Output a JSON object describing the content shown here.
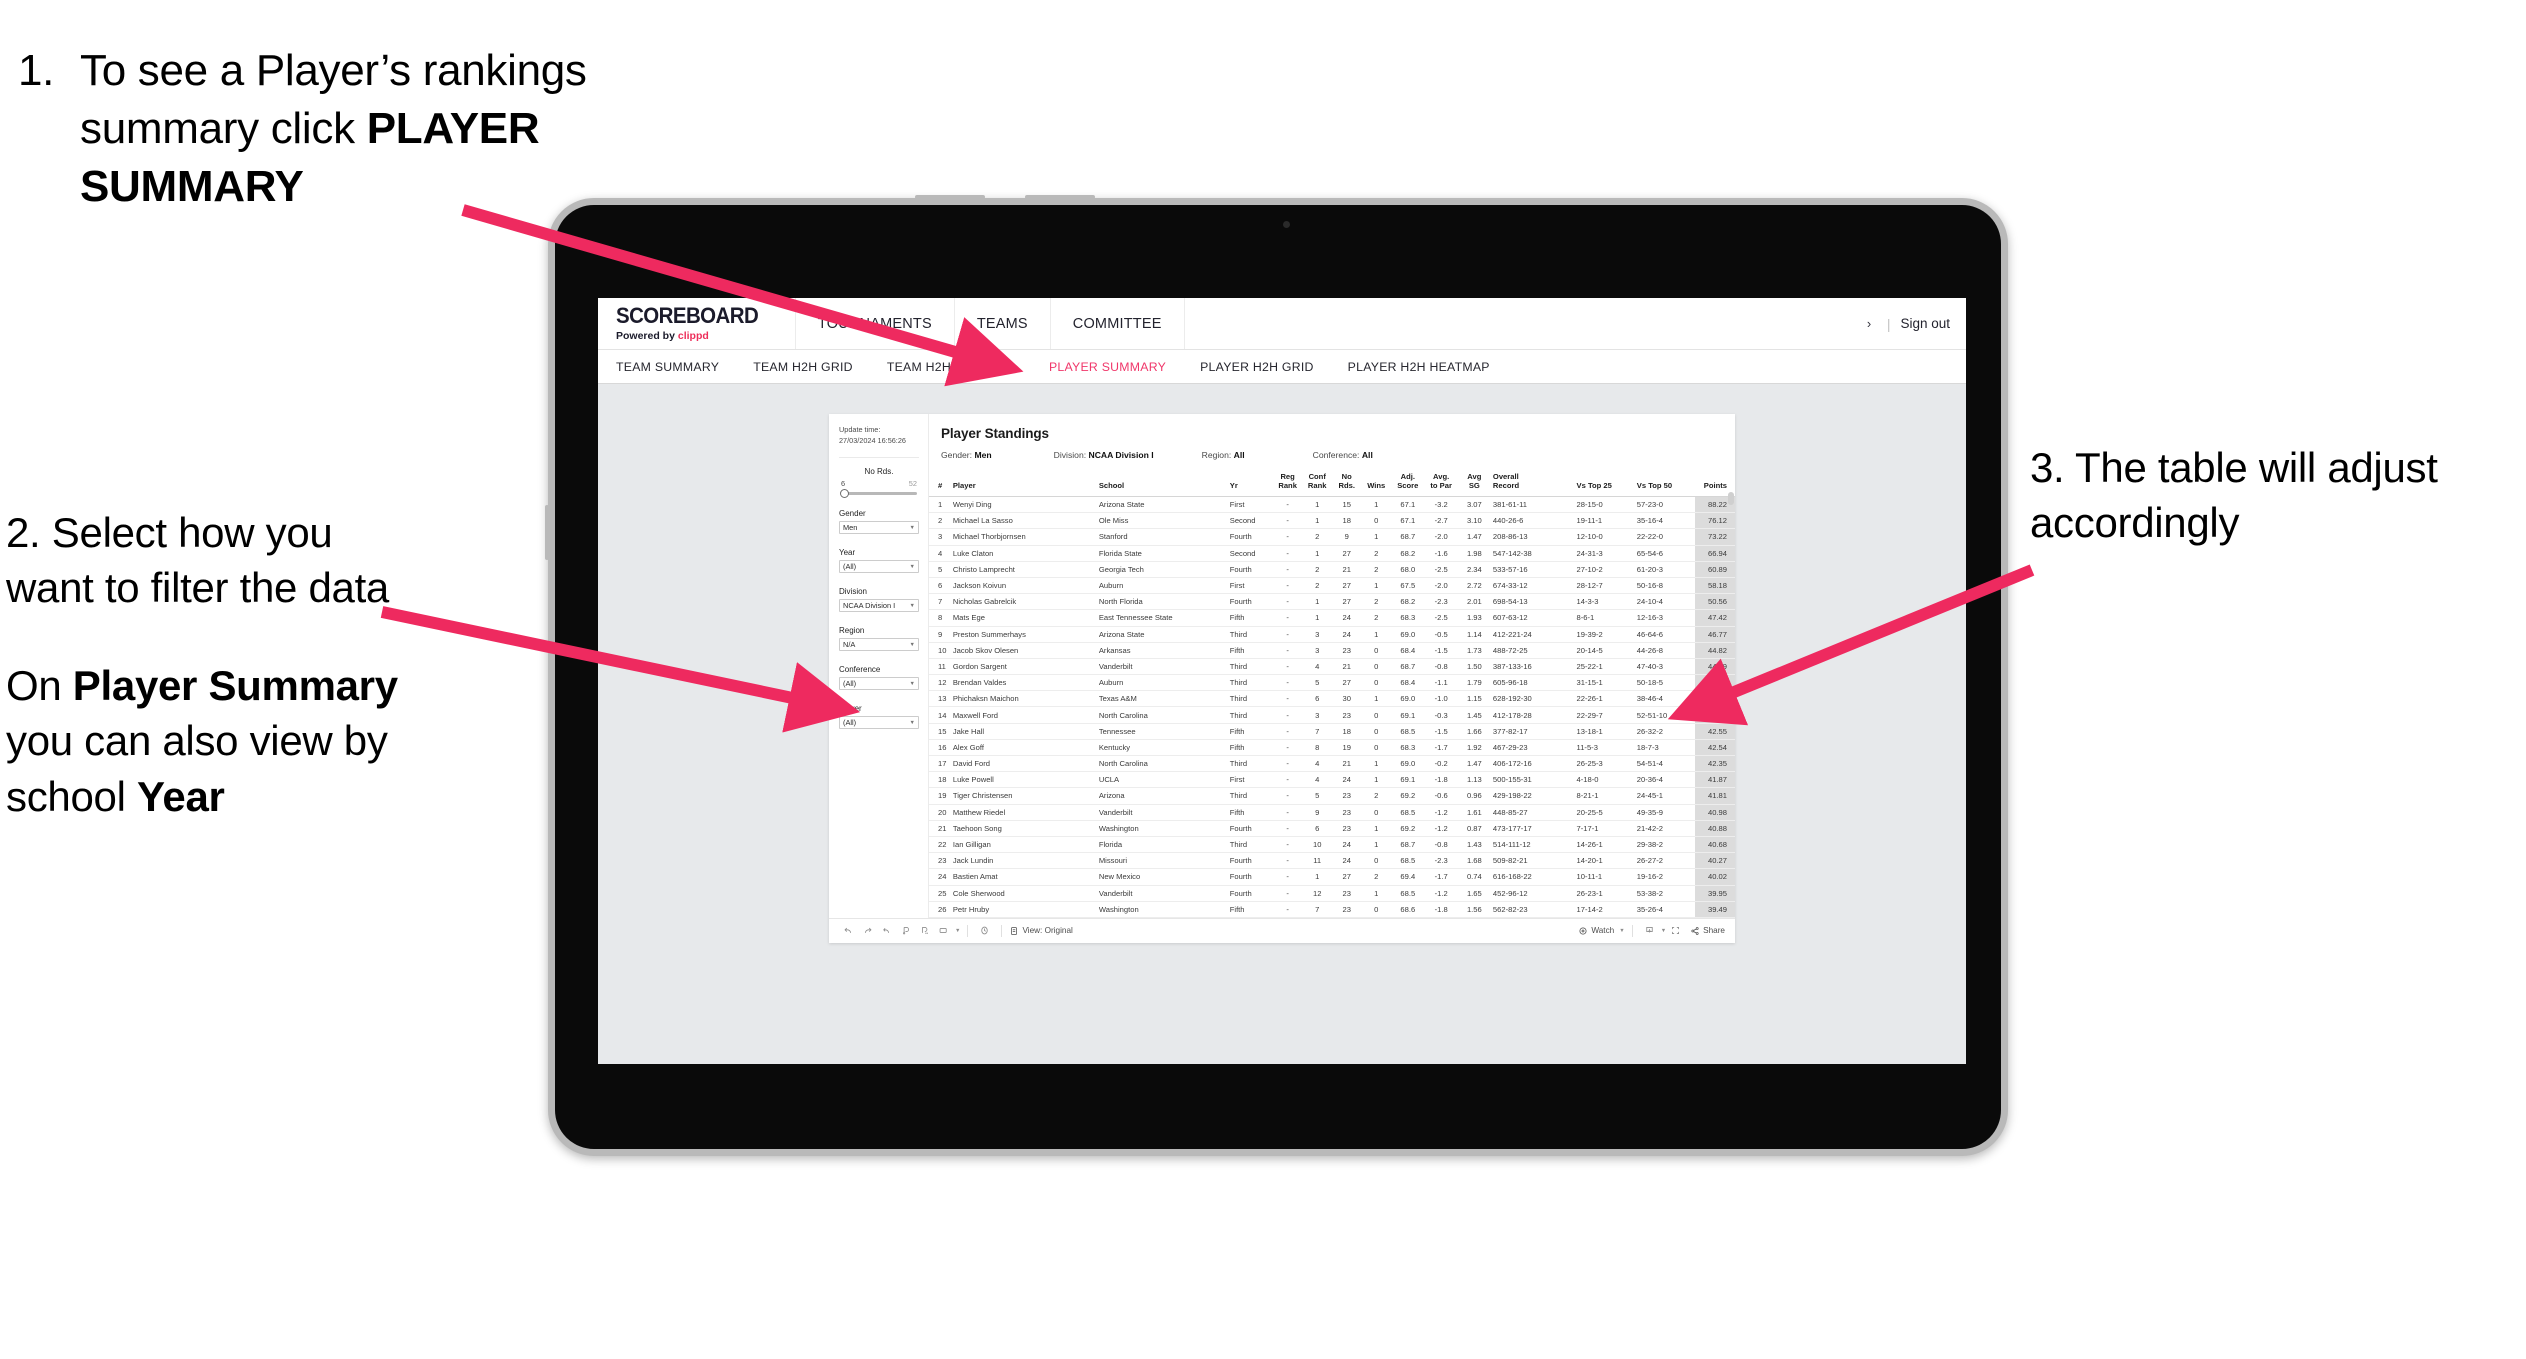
{
  "annotations": {
    "a1_num": "1.",
    "a1_line1": "To see a Player’s rankings",
    "a1_line2a": "summary click ",
    "a1_line2b": "PLAYER",
    "a1_line3b": "SUMMARY",
    "a2_p1": "2. Select how you want to filter the data",
    "a2_p2a": "On ",
    "a2_p2b": "Player Summary",
    "a2_p2c": " you can also view by school ",
    "a2_p2d": "Year",
    "a3": "3. The table will adjust accordingly"
  },
  "app": {
    "logo_word": "SCOREBOARD",
    "logo_sub_prefix": "Powered by ",
    "logo_sub_brand": "clippd",
    "top_nav": [
      "TOURNAMENTS",
      "TEAMS",
      "COMMITTEE"
    ],
    "header_right": {
      "truncated": "›",
      "divider": "|",
      "sign_out": "Sign out"
    },
    "sub_nav": [
      {
        "label": "TEAM SUMMARY",
        "active": false
      },
      {
        "label": "TEAM H2H GRID",
        "active": false
      },
      {
        "label": "TEAM H2H HEATMAP",
        "active": false
      },
      {
        "label": "PLAYER SUMMARY",
        "active": true
      },
      {
        "label": "PLAYER H2H GRID",
        "active": false
      },
      {
        "label": "PLAYER H2H HEATMAP",
        "active": false
      }
    ]
  },
  "filters": {
    "update_label": "Update time:",
    "update_value": "27/03/2024 16:56:26",
    "slider": {
      "label": "No Rds.",
      "min": "6",
      "max": "52"
    },
    "selects": [
      {
        "label": "Gender",
        "value": "Men"
      },
      {
        "label": "Year",
        "value": "(All)"
      },
      {
        "label": "Division",
        "value": "NCAA Division I"
      },
      {
        "label": "Region",
        "value": "N/A"
      },
      {
        "label": "Conference",
        "value": "(All)"
      },
      {
        "label": "Player",
        "value": "(All)"
      }
    ]
  },
  "viz": {
    "title": "Player Standings",
    "meta": [
      {
        "key": "Gender:",
        "value": "Men"
      },
      {
        "key": "Division:",
        "value": "NCAA Division I"
      },
      {
        "key": "Region:",
        "value": "All"
      },
      {
        "key": "Conference:",
        "value": "All"
      }
    ],
    "columns": [
      {
        "l1": "#",
        "l2": ""
      },
      {
        "l1": "Player",
        "l2": ""
      },
      {
        "l1": "School",
        "l2": ""
      },
      {
        "l1": "Yr",
        "l2": ""
      },
      {
        "l1": "Reg",
        "l2": "Rank"
      },
      {
        "l1": "Conf",
        "l2": "Rank"
      },
      {
        "l1": "No",
        "l2": "Rds."
      },
      {
        "l1": "Wins",
        "l2": ""
      },
      {
        "l1": "Adj.",
        "l2": "Score"
      },
      {
        "l1": "Avg.",
        "l2": "to Par"
      },
      {
        "l1": "Avg",
        "l2": "SG"
      },
      {
        "l1": "Overall",
        "l2": "Record"
      },
      {
        "l1": "Vs Top 25",
        "l2": ""
      },
      {
        "l1": "Vs Top 50",
        "l2": ""
      },
      {
        "l1": "Points",
        "l2": ""
      }
    ],
    "rows": [
      [
        "1",
        "Wenyi Ding",
        "Arizona State",
        "First",
        "-",
        "1",
        "15",
        "1",
        "67.1",
        "-3.2",
        "3.07",
        "381-61-11",
        "28-15-0",
        "57-23-0",
        "88.22"
      ],
      [
        "2",
        "Michael La Sasso",
        "Ole Miss",
        "Second",
        "-",
        "1",
        "18",
        "0",
        "67.1",
        "-2.7",
        "3.10",
        "440-26-6",
        "19-11-1",
        "35-16-4",
        "76.12"
      ],
      [
        "3",
        "Michael Thorbjornsen",
        "Stanford",
        "Fourth",
        "-",
        "2",
        "9",
        "1",
        "68.7",
        "-2.0",
        "1.47",
        "208-86-13",
        "12-10-0",
        "22-22-0",
        "73.22"
      ],
      [
        "4",
        "Luke Claton",
        "Florida State",
        "Second",
        "-",
        "1",
        "27",
        "2",
        "68.2",
        "-1.6",
        "1.98",
        "547-142-38",
        "24-31-3",
        "65-54-6",
        "66.94"
      ],
      [
        "5",
        "Christo Lamprecht",
        "Georgia Tech",
        "Fourth",
        "-",
        "2",
        "21",
        "2",
        "68.0",
        "-2.5",
        "2.34",
        "533-57-16",
        "27-10-2",
        "61-20-3",
        "60.89"
      ],
      [
        "6",
        "Jackson Koivun",
        "Auburn",
        "First",
        "-",
        "2",
        "27",
        "1",
        "67.5",
        "-2.0",
        "2.72",
        "674-33-12",
        "28-12-7",
        "50-16-8",
        "58.18"
      ],
      [
        "7",
        "Nicholas Gabrelcik",
        "North Florida",
        "Fourth",
        "-",
        "1",
        "27",
        "2",
        "68.2",
        "-2.3",
        "2.01",
        "698-54-13",
        "14-3-3",
        "24-10-4",
        "50.56"
      ],
      [
        "8",
        "Mats Ege",
        "East Tennessee State",
        "Fifth",
        "-",
        "1",
        "24",
        "2",
        "68.3",
        "-2.5",
        "1.93",
        "607-63-12",
        "8-6-1",
        "12-16-3",
        "47.42"
      ],
      [
        "9",
        "Preston Summerhays",
        "Arizona State",
        "Third",
        "-",
        "3",
        "24",
        "1",
        "69.0",
        "-0.5",
        "1.14",
        "412-221-24",
        "19-39-2",
        "46-64-6",
        "46.77"
      ],
      [
        "10",
        "Jacob Skov Olesen",
        "Arkansas",
        "Fifth",
        "-",
        "3",
        "23",
        "0",
        "68.4",
        "-1.5",
        "1.73",
        "488-72-25",
        "20-14-5",
        "44-26-8",
        "44.82"
      ],
      [
        "11",
        "Gordon Sargent",
        "Vanderbilt",
        "Third",
        "-",
        "4",
        "21",
        "0",
        "68.7",
        "-0.8",
        "1.50",
        "387-133-16",
        "25-22-1",
        "47-40-3",
        "44.49"
      ],
      [
        "12",
        "Brendan Valdes",
        "Auburn",
        "Third",
        "-",
        "5",
        "27",
        "0",
        "68.4",
        "-1.1",
        "1.79",
        "605-96-18",
        "31-15-1",
        "50-18-5",
        "43.95"
      ],
      [
        "13",
        "Phichaksn Maichon",
        "Texas A&M",
        "Third",
        "-",
        "6",
        "30",
        "1",
        "69.0",
        "-1.0",
        "1.15",
        "628-192-30",
        "22-26-1",
        "38-46-4",
        "43.83"
      ],
      [
        "14",
        "Maxwell Ford",
        "North Carolina",
        "Third",
        "-",
        "3",
        "23",
        "0",
        "69.1",
        "-0.3",
        "1.45",
        "412-178-28",
        "22-29-7",
        "52-51-10",
        "42.75"
      ],
      [
        "15",
        "Jake Hall",
        "Tennessee",
        "Fifth",
        "-",
        "7",
        "18",
        "0",
        "68.5",
        "-1.5",
        "1.66",
        "377-82-17",
        "13-18-1",
        "26-32-2",
        "42.55"
      ],
      [
        "16",
        "Alex Goff",
        "Kentucky",
        "Fifth",
        "-",
        "8",
        "19",
        "0",
        "68.3",
        "-1.7",
        "1.92",
        "467-29-23",
        "11-5-3",
        "18-7-3",
        "42.54"
      ],
      [
        "17",
        "David Ford",
        "North Carolina",
        "Third",
        "-",
        "4",
        "21",
        "1",
        "69.0",
        "-0.2",
        "1.47",
        "406-172-16",
        "26-25-3",
        "54-51-4",
        "42.35"
      ],
      [
        "18",
        "Luke Powell",
        "UCLA",
        "First",
        "-",
        "4",
        "24",
        "1",
        "69.1",
        "-1.8",
        "1.13",
        "500-155-31",
        "4-18-0",
        "20-36-4",
        "41.87"
      ],
      [
        "19",
        "Tiger Christensen",
        "Arizona",
        "Third",
        "-",
        "5",
        "23",
        "2",
        "69.2",
        "-0.6",
        "0.96",
        "429-198-22",
        "8-21-1",
        "24-45-1",
        "41.81"
      ],
      [
        "20",
        "Matthew Riedel",
        "Vanderbilt",
        "Fifth",
        "-",
        "9",
        "23",
        "0",
        "68.5",
        "-1.2",
        "1.61",
        "448-85-27",
        "20-25-5",
        "49-35-9",
        "40.98"
      ],
      [
        "21",
        "Taehoon Song",
        "Washington",
        "Fourth",
        "-",
        "6",
        "23",
        "1",
        "69.2",
        "-1.2",
        "0.87",
        "473-177-17",
        "7-17-1",
        "21-42-2",
        "40.88"
      ],
      [
        "22",
        "Ian Gilligan",
        "Florida",
        "Third",
        "-",
        "10",
        "24",
        "1",
        "68.7",
        "-0.8",
        "1.43",
        "514-111-12",
        "14-26-1",
        "29-38-2",
        "40.68"
      ],
      [
        "23",
        "Jack Lundin",
        "Missouri",
        "Fourth",
        "-",
        "11",
        "24",
        "0",
        "68.5",
        "-2.3",
        "1.68",
        "509-82-21",
        "14-20-1",
        "26-27-2",
        "40.27"
      ],
      [
        "24",
        "Bastien Amat",
        "New Mexico",
        "Fourth",
        "-",
        "1",
        "27",
        "2",
        "69.4",
        "-1.7",
        "0.74",
        "616-168-22",
        "10-11-1",
        "19-16-2",
        "40.02"
      ],
      [
        "25",
        "Cole Sherwood",
        "Vanderbilt",
        "Fourth",
        "-",
        "12",
        "23",
        "1",
        "68.5",
        "-1.2",
        "1.65",
        "452-96-12",
        "26-23-1",
        "53-38-2",
        "39.95"
      ],
      [
        "26",
        "Petr Hruby",
        "Washington",
        "Fifth",
        "-",
        "7",
        "23",
        "0",
        "68.6",
        "-1.8",
        "1.56",
        "562-82-23",
        "17-14-2",
        "35-26-4",
        "39.49"
      ]
    ]
  },
  "toolbar": {
    "left_icons": [
      "undo-icon",
      "redo-icon",
      "revert-icon",
      "refresh-icon",
      "pause-icon",
      "device-layout-icon"
    ],
    "history_icon": "history-icon",
    "view_label": "View: Original",
    "watch_label": "Watch",
    "share_label": "Share",
    "right_icons": [
      "download-icon",
      "fullscreen-icon"
    ]
  },
  "colors": {
    "accent": "#f0376a",
    "brand_red": "#ed2e5a",
    "arrow": "#ee2a5f",
    "workspace_bg": "#e7e9eb",
    "points_bg": "#dcdcdc"
  }
}
